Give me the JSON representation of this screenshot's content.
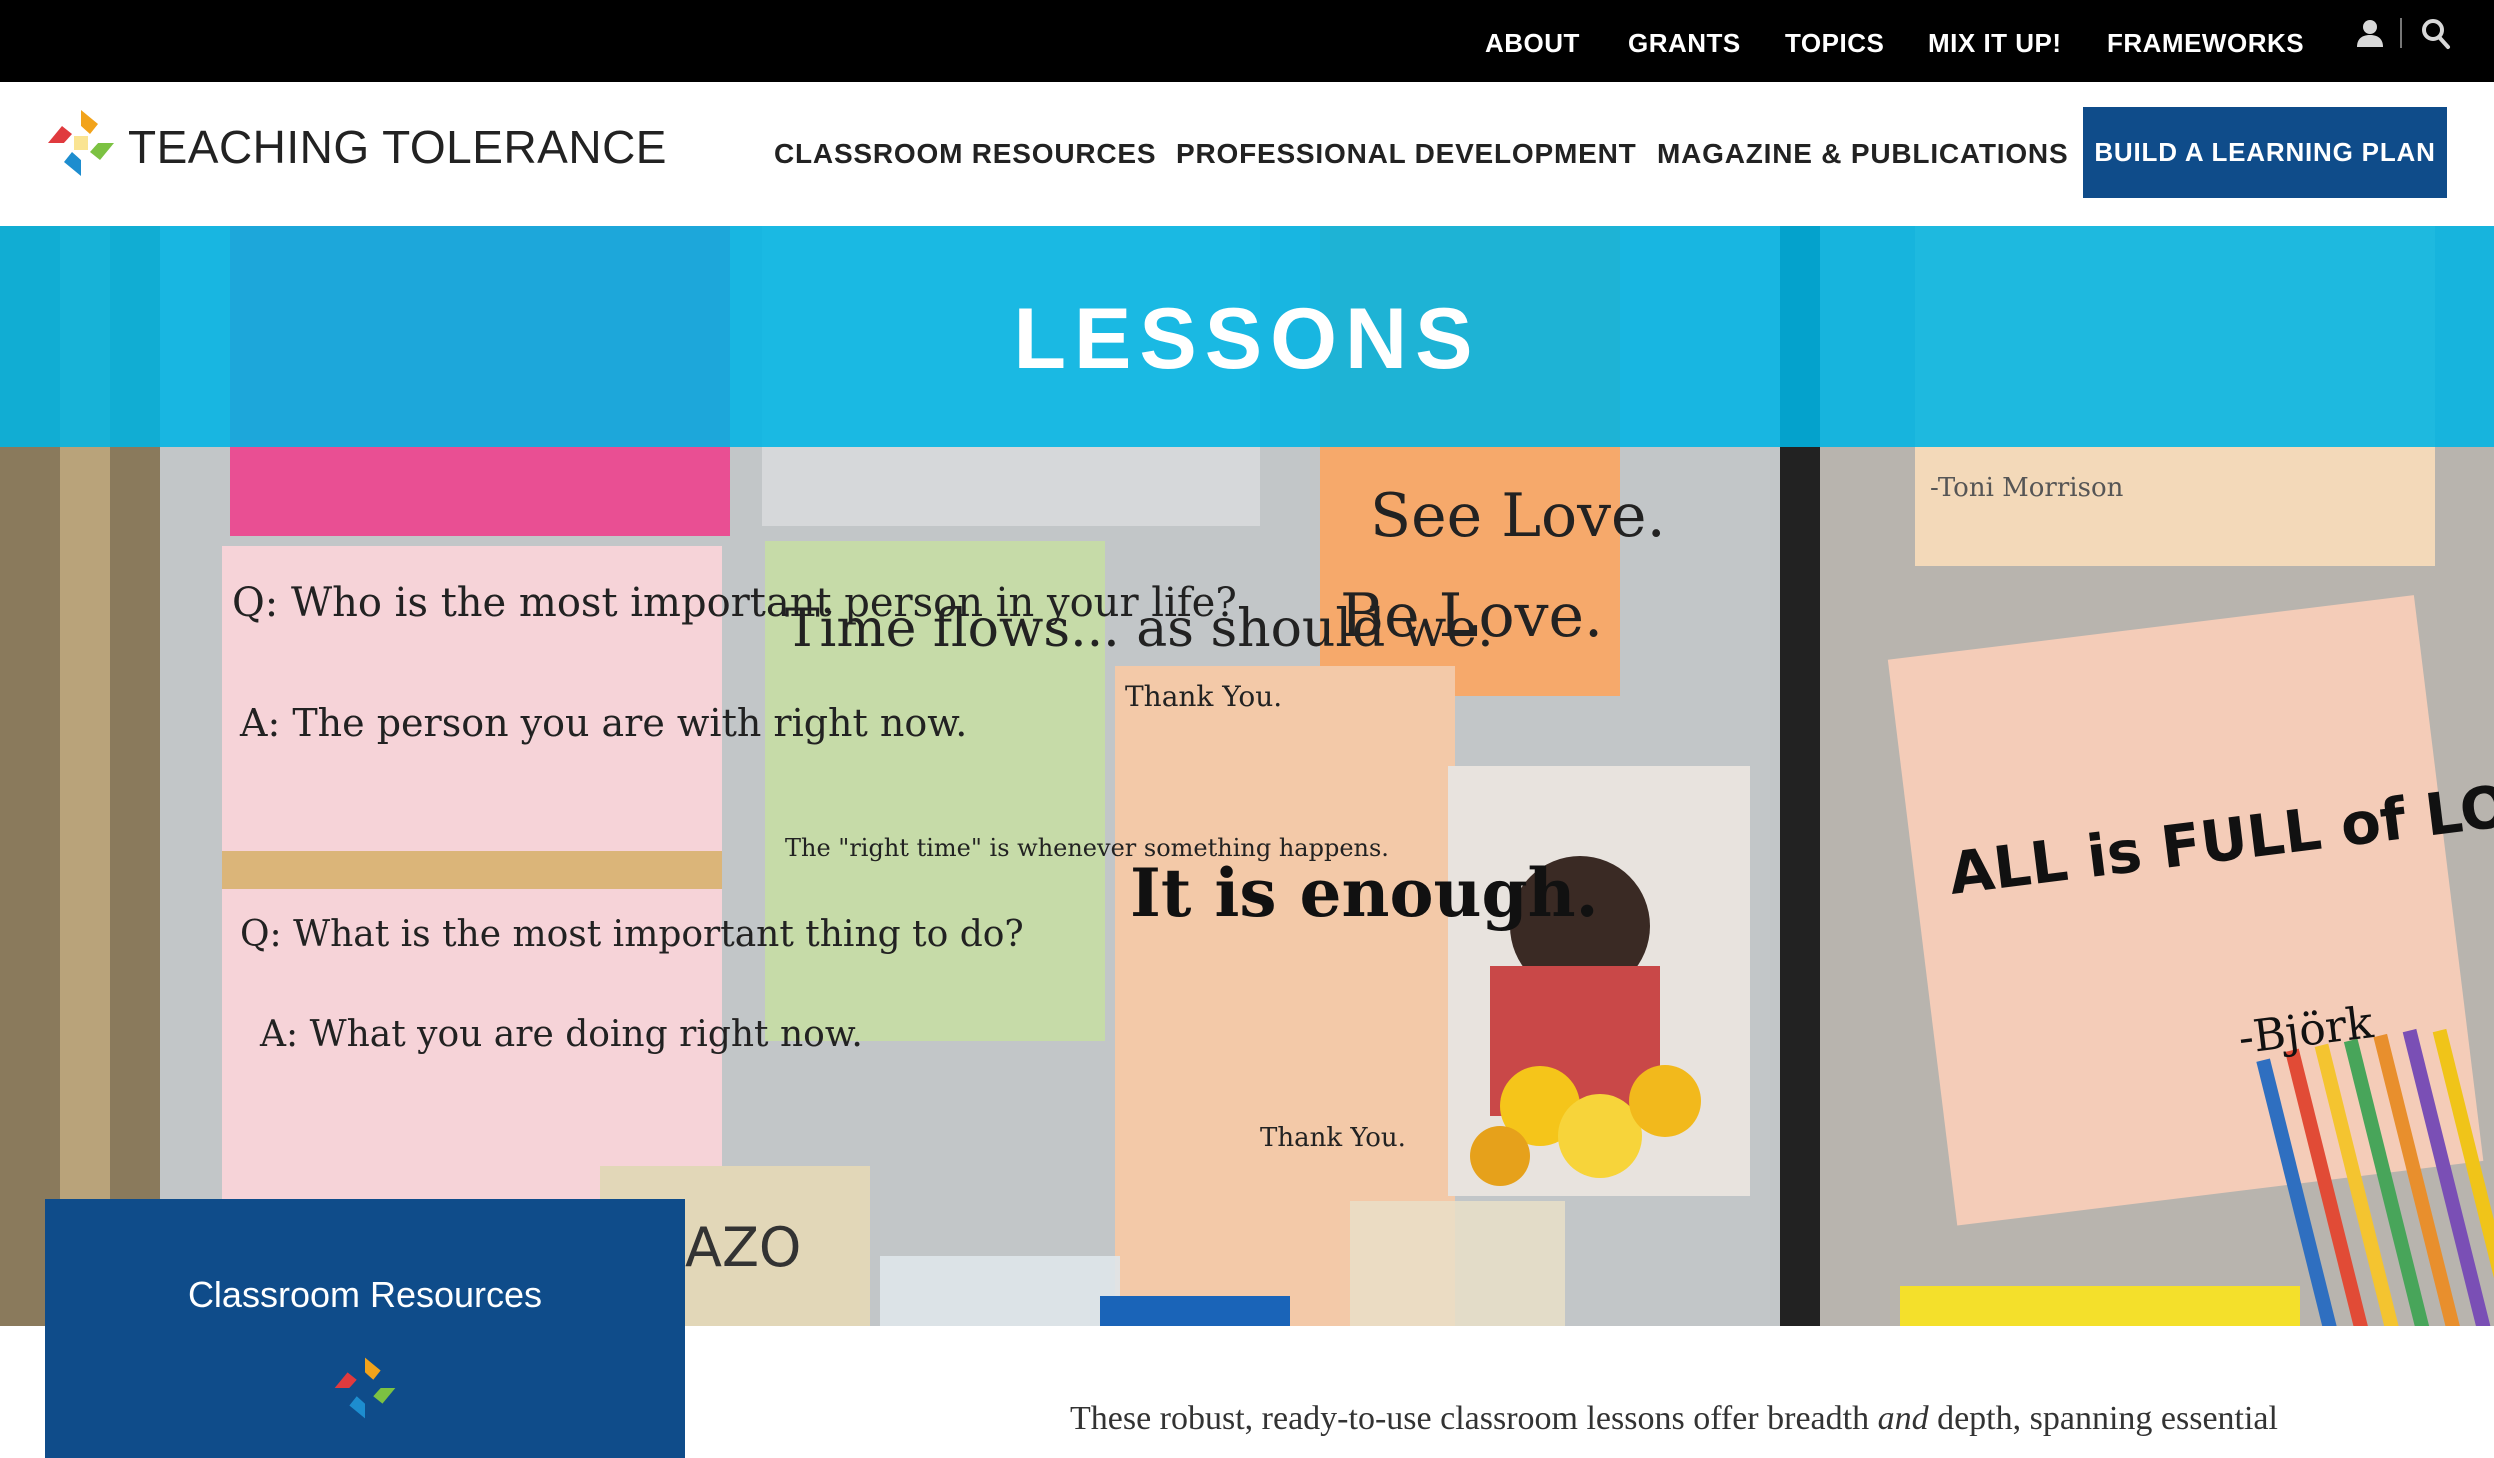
{
  "top_nav": {
    "items": [
      "ABOUT",
      "GRANTS",
      "TOPICS",
      "MIX IT UP!",
      "FRAMEWORKS"
    ],
    "icons": [
      "user-icon",
      "search-icon"
    ]
  },
  "header": {
    "logo_text": "TEACHING TOLERANCE",
    "nav": [
      "CLASSROOM RESOURCES",
      "PROFESSIONAL DEVELOPMENT",
      "MAGAZINE & PUBLICATIONS"
    ],
    "cta_label": "BUILD A LEARNING PLAN"
  },
  "hero": {
    "title": "LESSONS",
    "notes": {
      "q1": "Q: Who is the most important person in your life?",
      "a1": "A: The person you are with right now.",
      "q2": "Q: What is the most important thing to do?",
      "a2": "A: What you are doing right now.",
      "time": "Time flows... as should we.",
      "time_sub": "The \"right time\" is whenever something happens.",
      "thank_top": "Thank You.",
      "enough": "It is enough.",
      "thank_bottom": "Thank You.",
      "love1": "See Love.",
      "love2": "Be Love.",
      "all_love": "ALL is FULL of LOVE",
      "bjork": "-Björk",
      "morrison": "-Toni Morrison",
      "azo": "AZO"
    }
  },
  "resource_card": {
    "title": "Classroom Resources"
  },
  "intro": {
    "text_before": "These robust, ready-to-use classroom lessons offer breadth ",
    "emphasis": "and",
    "text_after": " depth, spanning essential"
  },
  "colors": {
    "top_bar": "#000000",
    "brand_blue": "#0f4c8a",
    "hero_banner": "#00b4e4"
  }
}
